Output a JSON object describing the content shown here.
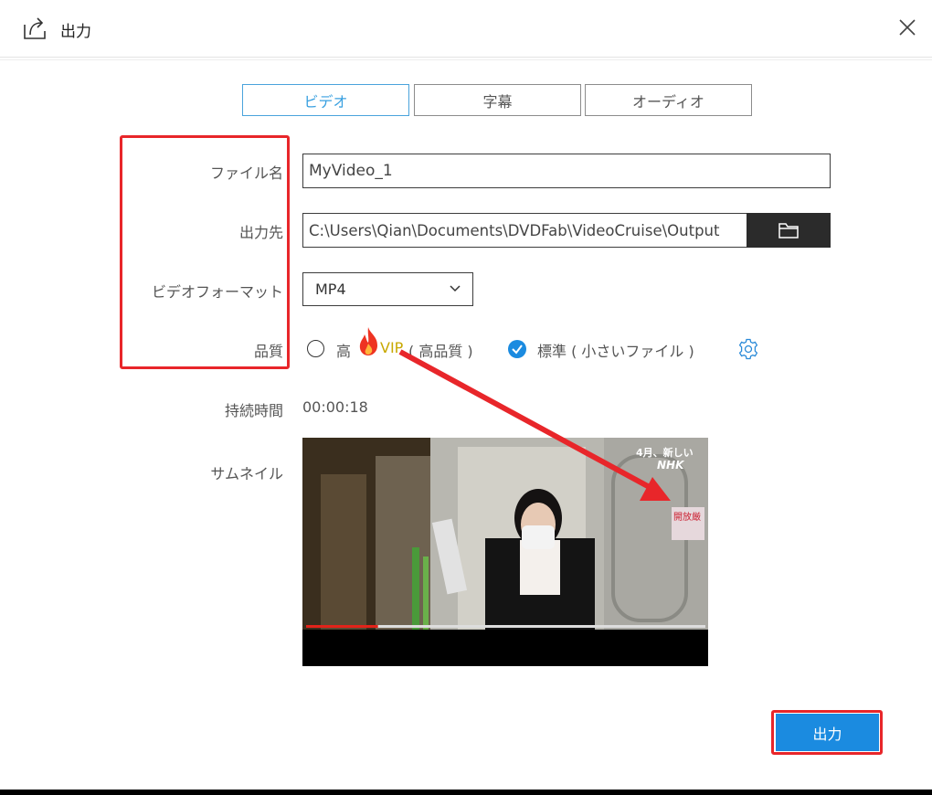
{
  "window": {
    "title": "出力"
  },
  "tabs": [
    {
      "label": "ビデオ",
      "active": true
    },
    {
      "label": "字幕",
      "active": false
    },
    {
      "label": "オーディオ",
      "active": false
    }
  ],
  "form": {
    "filename_label": "ファイル名",
    "filename_value": "MyVideo_1",
    "output_label": "出力先",
    "output_path": "C:\\Users\\Qian\\Documents\\DVDFab\\VideoCruise\\Output",
    "format_label": "ビデオフォーマット",
    "format_value": "MP4",
    "quality_label": "品質",
    "quality_high": "高",
    "quality_vip": "VIP",
    "quality_high_suffix": "( 高品質 )",
    "quality_standard": "標準 ( 小さいファイル )",
    "duration_label": "持続時間",
    "duration_value": "00:00:18",
    "thumbnail_label": "サムネイル"
  },
  "thumbnail": {
    "caption_line1": "4月、新しい",
    "caption_logo": "NHK",
    "sign_text": "開放厳",
    "progress_fraction": 0.18
  },
  "actions": {
    "export_label": "出力"
  },
  "colors": {
    "accent_blue": "#1b8be0",
    "tab_active": "#39a0e0",
    "annotation_red": "#e8262a",
    "vip_gold": "#c8a800"
  },
  "icons": {
    "title": "export-icon",
    "close": "close-icon",
    "folder": "folder-icon",
    "dropdown": "chevron-down-icon",
    "vip": "flame-icon",
    "settings": "gear-icon"
  }
}
